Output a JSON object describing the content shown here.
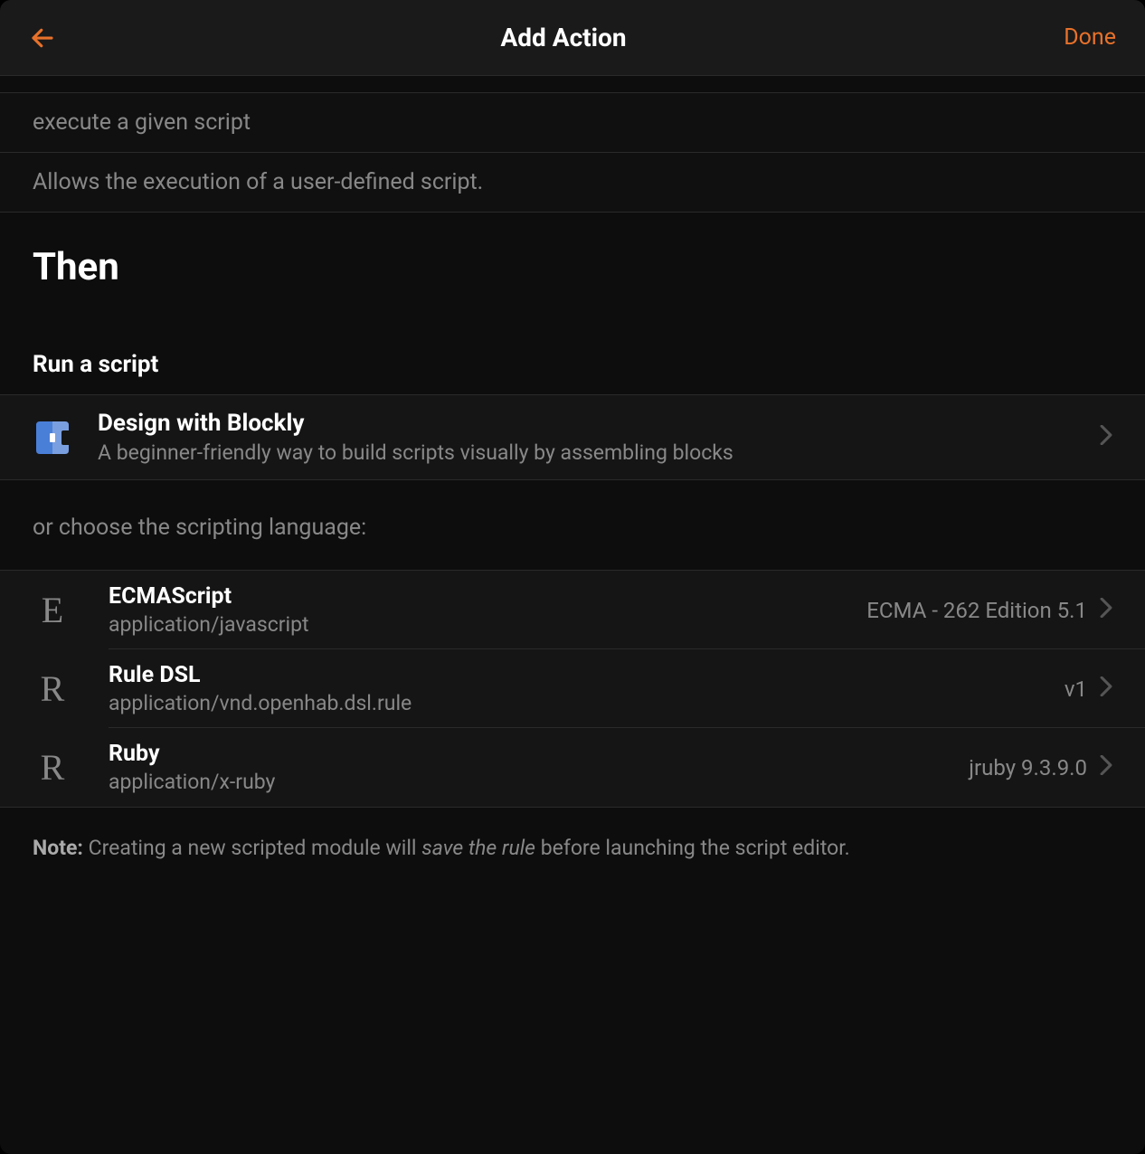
{
  "header": {
    "title": "Add Action",
    "done_label": "Done"
  },
  "input": {
    "value": "execute a given script",
    "description": "Allows the execution of a user-defined script."
  },
  "then": {
    "title": "Then",
    "run_script_label": "Run a script"
  },
  "blockly": {
    "title": "Design with Blockly",
    "subtitle": "A beginner-friendly way to build scripts visually by assembling blocks"
  },
  "choose_language_label": "or choose the scripting language:",
  "languages": [
    {
      "letter": "E",
      "title": "ECMAScript",
      "subtitle": "application/javascript",
      "version": "ECMA - 262 Edition 5.1"
    },
    {
      "letter": "R",
      "title": "Rule DSL",
      "subtitle": "application/vnd.openhab.dsl.rule",
      "version": "v1"
    },
    {
      "letter": "R",
      "title": "Ruby",
      "subtitle": "application/x-ruby",
      "version": "jruby 9.3.9.0"
    }
  ],
  "note": {
    "bold": "Note:",
    "text1": " Creating a new scripted module will ",
    "italic": "save the rule",
    "text2": " before launching the script editor."
  }
}
